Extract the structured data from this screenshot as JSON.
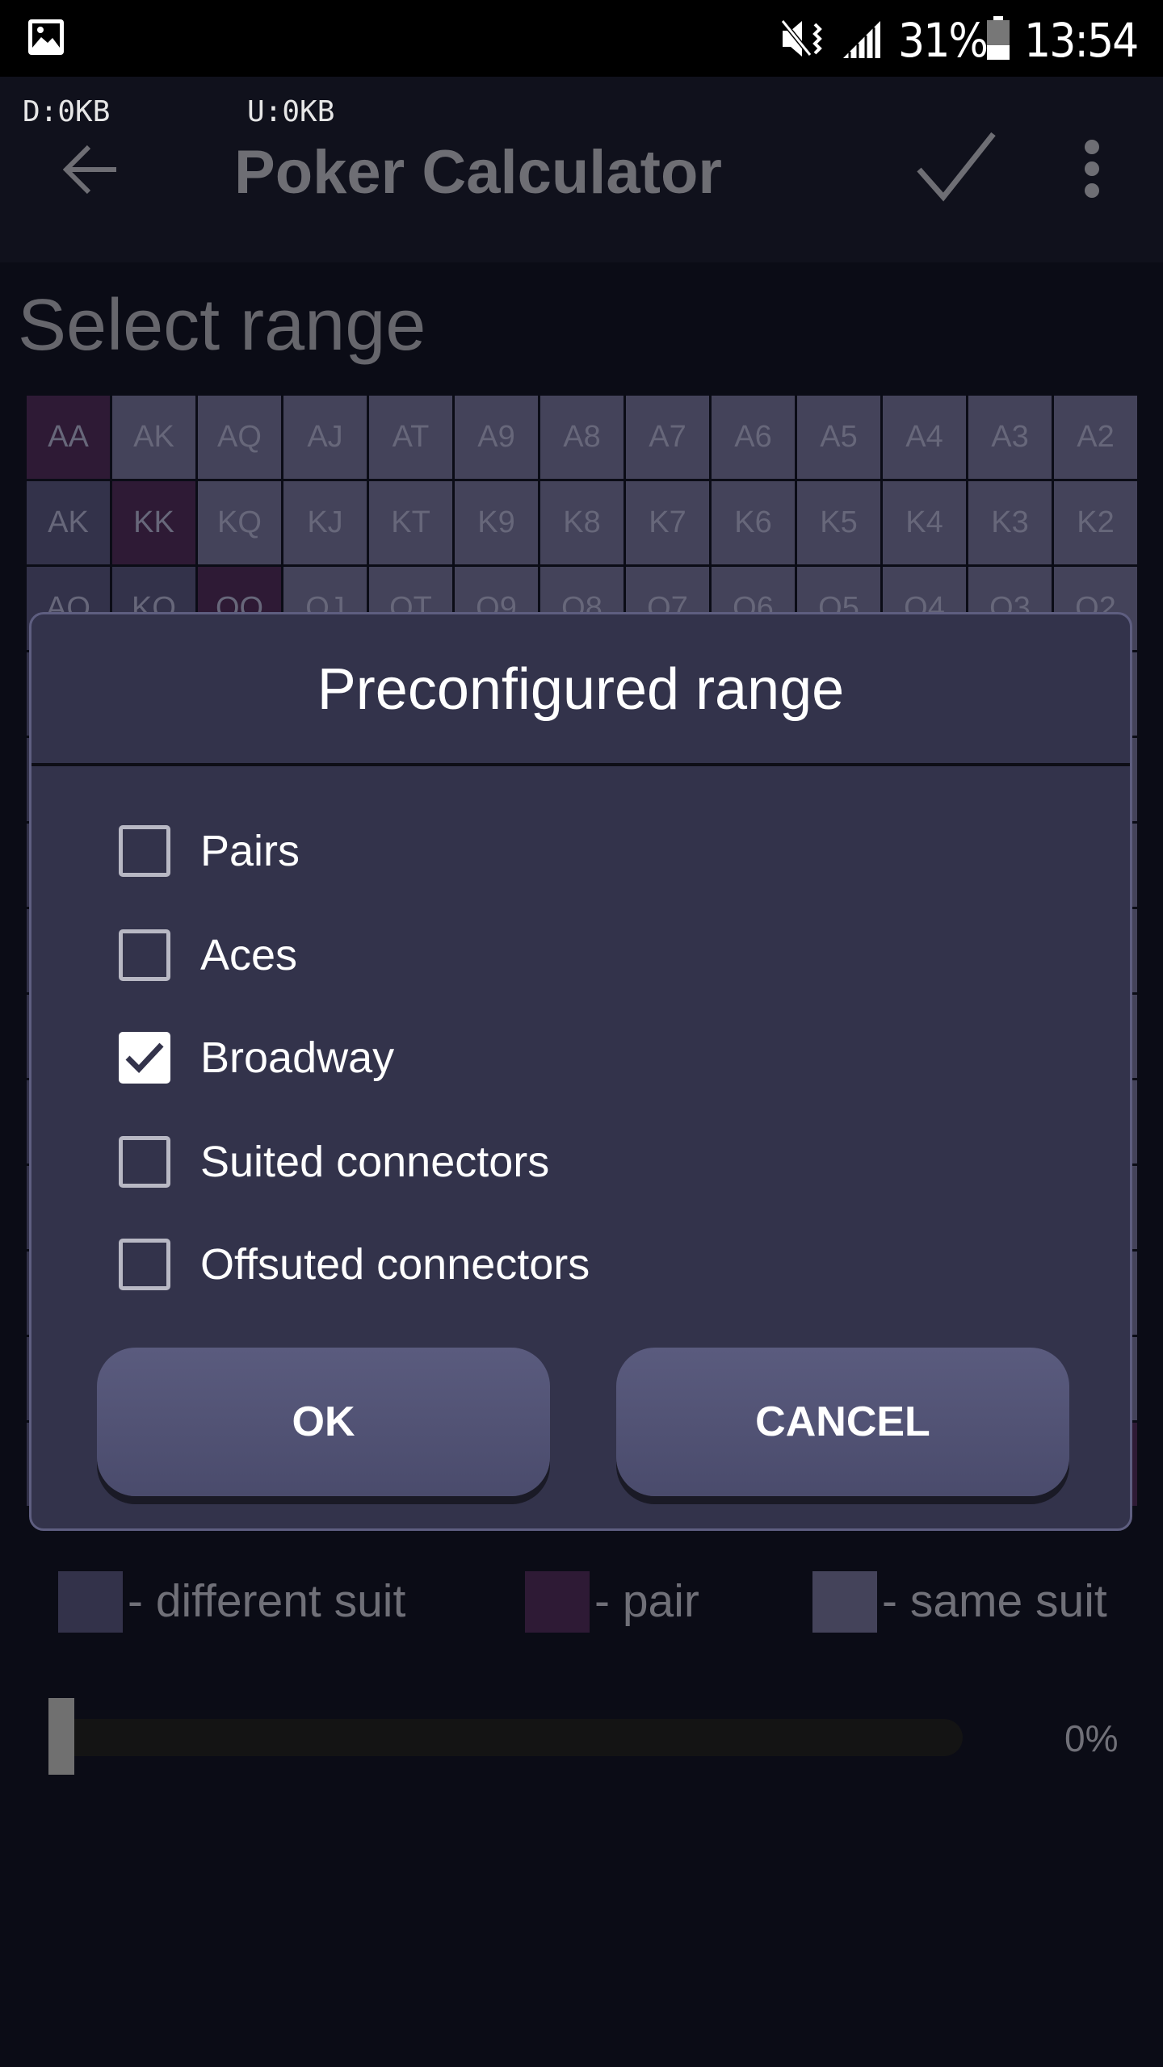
{
  "status_bar": {
    "time": "13:54",
    "battery": "31%",
    "icons": [
      "image-icon",
      "mute-vibrate-icon",
      "signal-icon",
      "battery-icon"
    ]
  },
  "net_speed": {
    "download": "D:0KB",
    "upload": "U:0KB"
  },
  "app_bar": {
    "title": "Poker Calculator",
    "icons": [
      "back-arrow-icon",
      "check-icon",
      "more-vert-icon"
    ]
  },
  "page": {
    "heading": "Select range"
  },
  "grid": {
    "ranks": [
      "A",
      "K",
      "Q",
      "J",
      "T",
      "9",
      "8",
      "7",
      "6",
      "5",
      "4",
      "3",
      "2"
    ],
    "colors": {
      "pair": "#2e1a35",
      "same_suit": "#44435a",
      "different_suit": "#33324a"
    }
  },
  "dialog": {
    "title": "Preconfigured range",
    "options": [
      {
        "label": "Pairs",
        "checked": false
      },
      {
        "label": "Aces",
        "checked": false
      },
      {
        "label": "Broadway",
        "checked": true
      },
      {
        "label": "Suited connectors",
        "checked": false
      },
      {
        "label": "Offsuted connectors",
        "checked": false
      }
    ],
    "ok_label": "OK",
    "cancel_label": "CANCEL"
  },
  "legend": {
    "different_suit": "- different suit",
    "pair": "- pair",
    "same_suit": "- same suit"
  },
  "range_slider": {
    "value_percent": 0,
    "label": "0%"
  }
}
